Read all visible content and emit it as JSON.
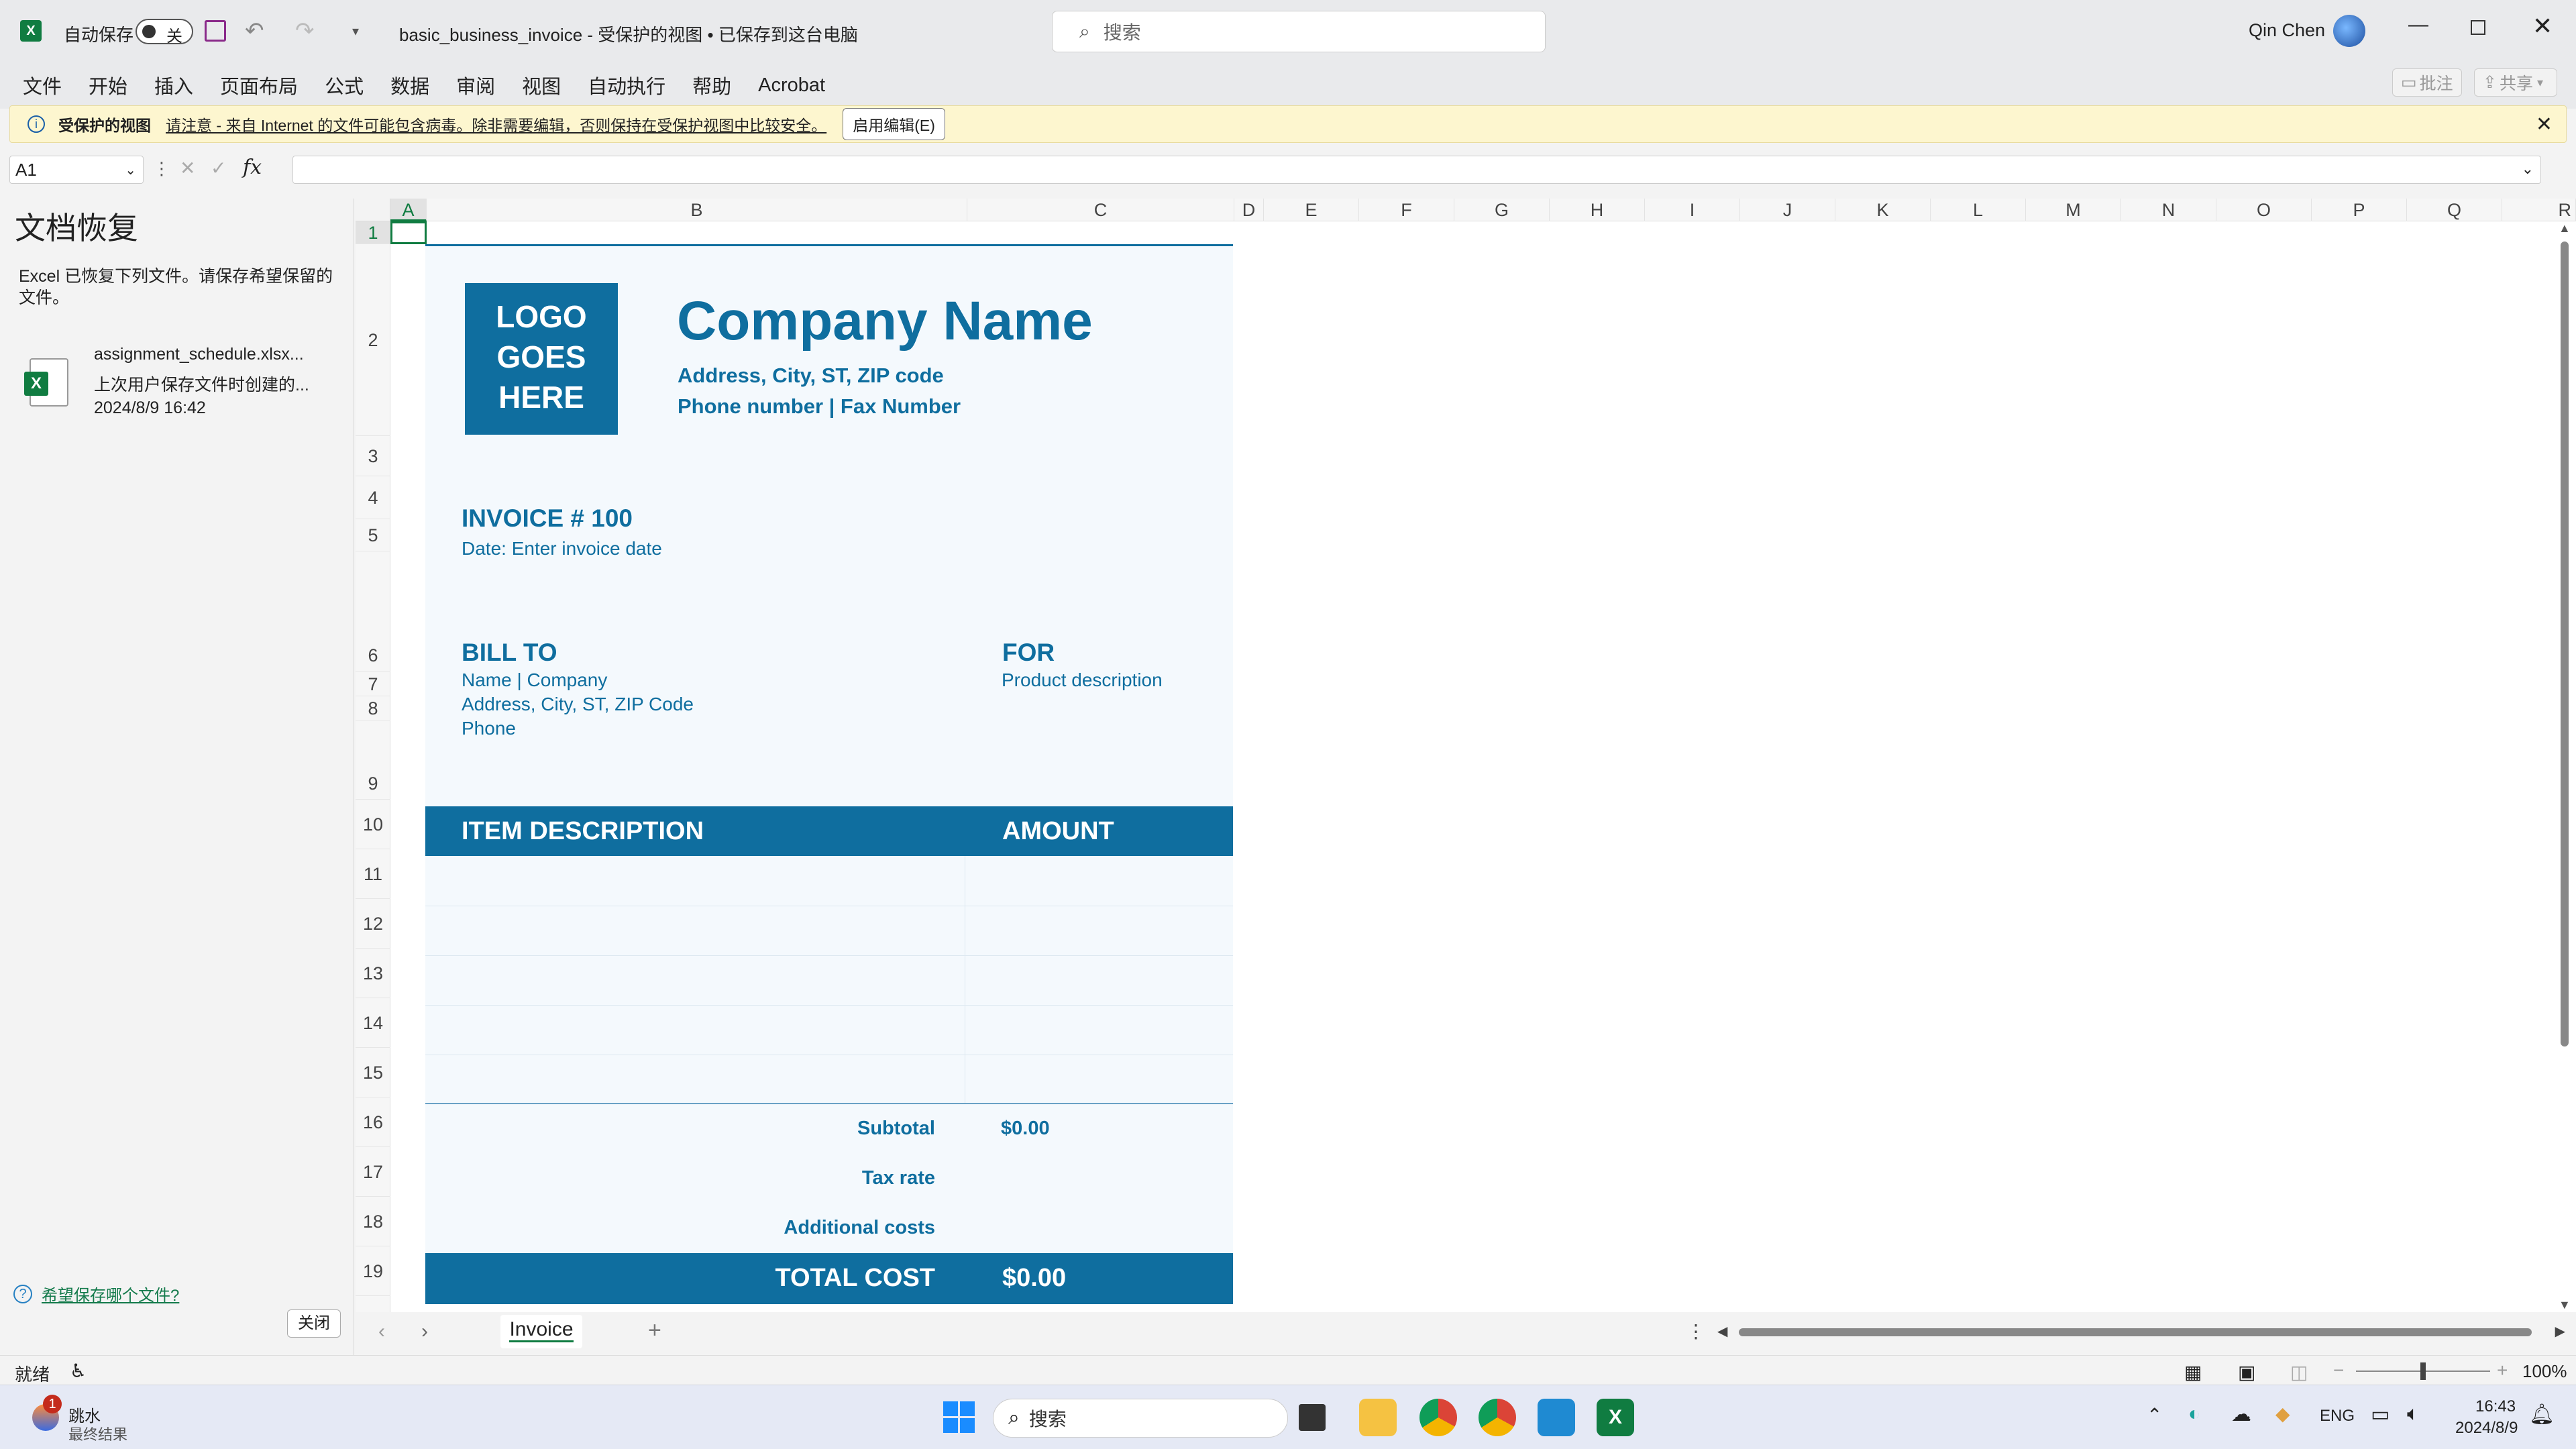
{
  "titlebar": {
    "autosave_label": "自动保存",
    "autosave_state": "关",
    "document_title": "basic_business_invoice  -  受保护的视图 • 已保存到这台电脑",
    "search_placeholder": "搜索",
    "user_name": "Qin Chen"
  },
  "ribbon": {
    "tabs": [
      "文件",
      "开始",
      "插入",
      "页面布局",
      "公式",
      "数据",
      "审阅",
      "视图",
      "自动执行",
      "帮助",
      "Acrobat"
    ],
    "comments_label": "批注",
    "share_label": "共享"
  },
  "protected_bar": {
    "title": "受保护的视图",
    "message": "请注意 - 来自 Internet 的文件可能包含病毒。除非需要编辑，否则保持在受保护视图中比较安全。",
    "enable_button": "启用编辑(E)"
  },
  "formula_bar": {
    "name_box": "A1",
    "fx": "fx",
    "formula": ""
  },
  "recovery_pane": {
    "title": "文档恢复",
    "description": "Excel 已恢复下列文件。请保存希望保留的文件。",
    "file_name": "assignment_schedule.xlsx...",
    "file_desc": "上次用户保存文件时创建的...",
    "file_time": "2024/8/9 16:42",
    "help_link": "希望保存哪个文件?",
    "close_button": "关闭"
  },
  "grid": {
    "columns": [
      "A",
      "B",
      "C",
      "D",
      "E",
      "F",
      "G",
      "H",
      "I",
      "J",
      "K",
      "L",
      "M",
      "N",
      "O",
      "P",
      "Q",
      "R"
    ],
    "rows": [
      "1",
      "2",
      "3",
      "4",
      "5",
      "6",
      "7",
      "8",
      "9",
      "10",
      "11",
      "12",
      "13",
      "14",
      "15",
      "16",
      "17",
      "18",
      "19"
    ]
  },
  "invoice": {
    "logo_lines": [
      "LOGO",
      "GOES",
      "HERE"
    ],
    "company_name": "Company Name",
    "company_address": "Address, City, ST, ZIP code",
    "company_phone": "Phone number | Fax Number",
    "invoice_number": "INVOICE # 100",
    "invoice_date": "Date: Enter invoice date",
    "bill_to_header": "BILL TO",
    "bill_to_name": "Name | Company",
    "bill_to_address": "Address, City, ST, ZIP Code",
    "bill_to_phone": "Phone",
    "for_header": "FOR",
    "for_desc": "Product description",
    "item_header": "ITEM DESCRIPTION",
    "amount_header": "AMOUNT",
    "subtotal_label": "Subtotal",
    "subtotal_value": "$0.00",
    "tax_label": "Tax rate",
    "additional_label": "Additional costs",
    "total_label": "TOTAL COST",
    "total_value": "$0.00"
  },
  "sheet_tabs": {
    "active": "Invoice"
  },
  "status": {
    "ready": "就绪",
    "zoom": "100%"
  },
  "taskbar": {
    "weather_title": "跳水",
    "weather_sub": "最终结果",
    "notification_count": "1",
    "search_placeholder": "搜索",
    "lang": "ENG",
    "time": "16:43",
    "date": "2024/8/9"
  },
  "colors": {
    "invoice_blue": "#0f6e9f",
    "invoice_bg": "#f4f9fd",
    "excel_green": "#107c41"
  }
}
